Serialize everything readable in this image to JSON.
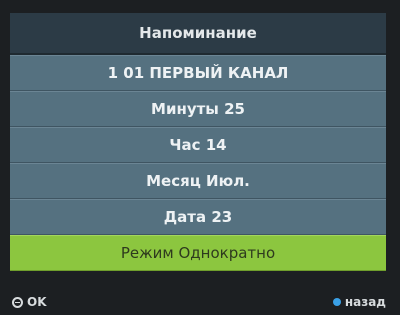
{
  "dialog": {
    "title": "Напоминание",
    "items": [
      {
        "label": "1 01 ПЕРВЫЙ КАНАЛ"
      },
      {
        "label": "Минуты 25"
      },
      {
        "label": "Час 14"
      },
      {
        "label": "Месяц Июл."
      },
      {
        "label": "Дата 23"
      },
      {
        "label": "Режим Однократно"
      }
    ],
    "selected_index": 5
  },
  "footer": {
    "ok_label": "OK",
    "ok_icon": "ok-button-icon",
    "back_label": "назад",
    "back_icon": "blue-button-icon"
  },
  "colors": {
    "header_bg": "#2c3b46",
    "row_bg": "#557180",
    "selected_bg": "#8cc63f",
    "back_dot": "#3aa0e6"
  }
}
